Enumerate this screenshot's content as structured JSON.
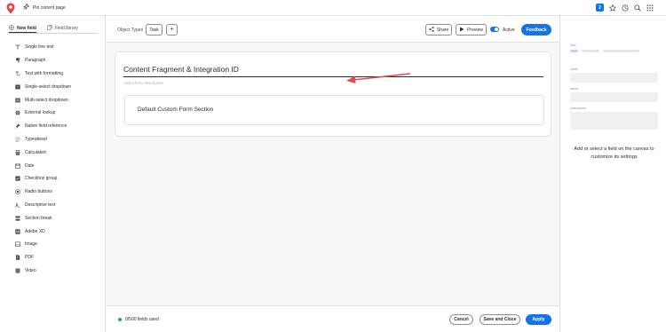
{
  "topbar": {
    "pin_label": "Pin current page",
    "badge_count": "2",
    "icons": [
      "star-icon",
      "history-icon",
      "search-icon",
      "apps-grid-icon"
    ]
  },
  "left_panel": {
    "tabs": [
      {
        "label": "New field",
        "icon": "plus-circle-icon",
        "active": true
      },
      {
        "label": "Field library",
        "icon": "library-icon",
        "active": false
      }
    ],
    "fields": [
      {
        "label": "Single line text",
        "icon": "text-icon"
      },
      {
        "label": "Paragraph",
        "icon": "paragraph-icon"
      },
      {
        "label": "Text with formatting",
        "icon": "text-format-icon"
      },
      {
        "label": "Single-select dropdown",
        "icon": "dropdown-icon"
      },
      {
        "label": "Multi-select dropdown",
        "icon": "multi-dropdown-icon"
      },
      {
        "label": "External lookup",
        "icon": "globe-icon"
      },
      {
        "label": "Native field reference",
        "icon": "pin-icon"
      },
      {
        "label": "Typeahead",
        "icon": "typeahead-icon"
      },
      {
        "label": "Calculated",
        "icon": "calculator-icon"
      },
      {
        "label": "Date",
        "icon": "calendar-icon"
      },
      {
        "label": "Checkbox group",
        "icon": "checkbox-icon"
      },
      {
        "label": "Radio buttons",
        "icon": "radio-icon"
      },
      {
        "label": "Descriptive text",
        "icon": "descriptive-text-icon"
      },
      {
        "label": "Section break",
        "icon": "section-break-icon"
      },
      {
        "label": "Adobe XD",
        "icon": "adobe-xd-icon"
      },
      {
        "label": "Image",
        "icon": "image-icon"
      },
      {
        "label": "PDF",
        "icon": "pdf-icon"
      },
      {
        "label": "Video",
        "icon": "video-icon"
      }
    ]
  },
  "toolbar": {
    "object_types_label": "Object Types",
    "object_type_chip": "Task",
    "add_label": "+",
    "share_label": "Share",
    "preview_label": "Preview",
    "active_label": "Active",
    "active": true,
    "feedback_label": "Feedback"
  },
  "form": {
    "title": "Content Fragment & Integration ID",
    "description_placeholder": "Add a form description",
    "section_title": "Default Custom Form Section"
  },
  "footer": {
    "fields_used": "0/500 fields used",
    "cancel_label": "Cancel",
    "save_close_label": "Save and Close",
    "apply_label": "Apply"
  },
  "right_panel": {
    "size_label": "Size",
    "label_label": "Label",
    "name_label": "Name",
    "instructions_label": "Instructions",
    "hint": "Add or select a field on the canvas to customize its settings"
  },
  "colors": {
    "accent": "#1473e6",
    "arrow": "#e34850",
    "status_dot": "#2d9d78"
  }
}
